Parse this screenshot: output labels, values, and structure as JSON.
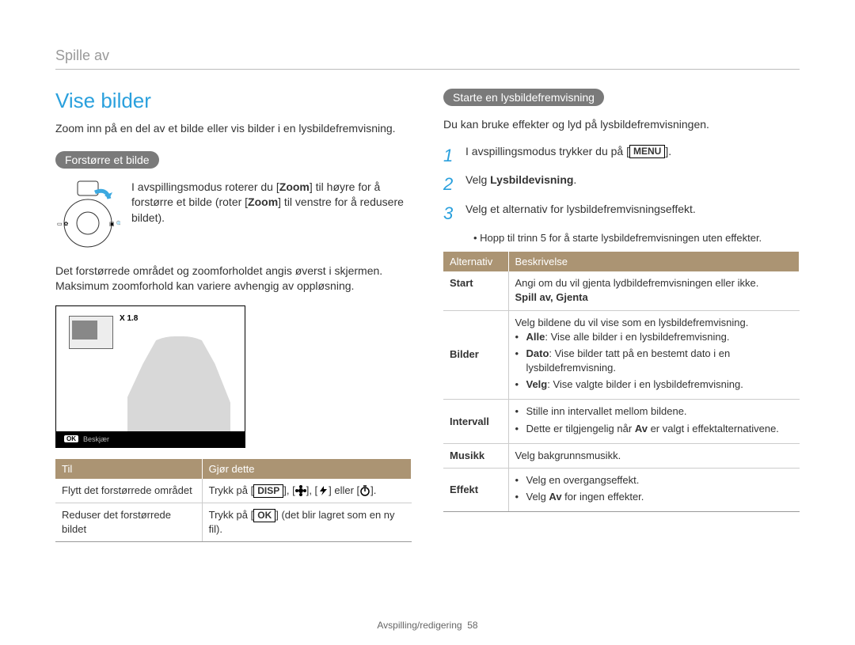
{
  "breadcrumb": "Spille av",
  "title": "Vise bilder",
  "intro": "Zoom inn på en del av et bilde eller vis bilder i en lysbildefremvisning.",
  "left": {
    "pill": "Forstørre et bilde",
    "zoom_text_a": "I avspillingsmodus roterer du [",
    "zoom_text_b": "] til høyre for å forstørre et bilde (roter [",
    "zoom_text_c": "] til venstre for å redusere bildet).",
    "zoom_kw": "Zoom",
    "para2": "Det forstørrede området og zoomforholdet angis øverst i skjermen. Maksimum zoomforhold kan variere avhengig av oppløsning.",
    "preview": {
      "zoom": "X 1.8",
      "ok": "OK",
      "crop": "Beskjær"
    },
    "table": {
      "head": [
        "Til",
        "Gjør dette"
      ],
      "rows": [
        {
          "c0": "Flytt det forstørrede området",
          "c1_a": "Trykk på [",
          "c1_keys": [
            "DISP"
          ],
          "c1_mid": "], [",
          "c1_b": "], [",
          "c1_c": "] eller [",
          "c1_d": "]."
        },
        {
          "c0": "Reduser det forstørrede bildet",
          "c1_a": "Trykk på [",
          "c1_keys": [
            "OK"
          ],
          "c1_b": "] (det blir lagret som en ny fil)."
        }
      ]
    }
  },
  "right": {
    "pill": "Starte en lysbildefremvisning",
    "intro": "Du kan bruke effekter og lyd på lysbildefremvisningen.",
    "steps": [
      {
        "n": "1",
        "a": "I avspillingsmodus trykker du på [",
        "key": "MENU",
        "b": "]."
      },
      {
        "n": "2",
        "a": "Velg ",
        "bold": "Lysbildevisning",
        "b": "."
      },
      {
        "n": "3",
        "a": "Velg et alternativ for lysbildefremvisningseffekt."
      }
    ],
    "note": "Hopp til trinn 5 for å starte lysbildefremvisningen uten effekter.",
    "table": {
      "head": [
        "Alternativ",
        "Beskrivelse"
      ],
      "rows": [
        {
          "c0": "Start",
          "desc": "Angi om du vil gjenta lydbildefremvisningen eller ikke.",
          "opts": "Spill av, Gjenta"
        },
        {
          "c0": "Bilder",
          "desc": "Velg bildene du vil vise som en lysbildefremvisning.",
          "items": [
            {
              "bold": "Alle",
              "text": ": Vise alle bilder i en lysbildefremvisning."
            },
            {
              "bold": "Dato",
              "text": ": Vise bilder tatt på en bestemt dato i en lysbildefremvisning."
            },
            {
              "bold": "Velg",
              "text": ": Vise valgte bilder i en lysbildefremvisning."
            }
          ]
        },
        {
          "c0": "Intervall",
          "items": [
            {
              "text": "Stille inn intervallet mellom bildene."
            },
            {
              "pre": "Dette er tilgjengelig når ",
              "bold": "Av",
              "text": " er valgt i effektalternativene."
            }
          ]
        },
        {
          "c0": "Musikk",
          "desc": "Velg bakgrunnsmusikk."
        },
        {
          "c0": "Effekt",
          "items": [
            {
              "text": "Velg en overgangseffekt."
            },
            {
              "pre": "Velg ",
              "bold": "Av",
              "text": " for ingen effekter."
            }
          ]
        }
      ]
    }
  },
  "footer": {
    "section": "Avspilling/redigering",
    "page": "58"
  }
}
